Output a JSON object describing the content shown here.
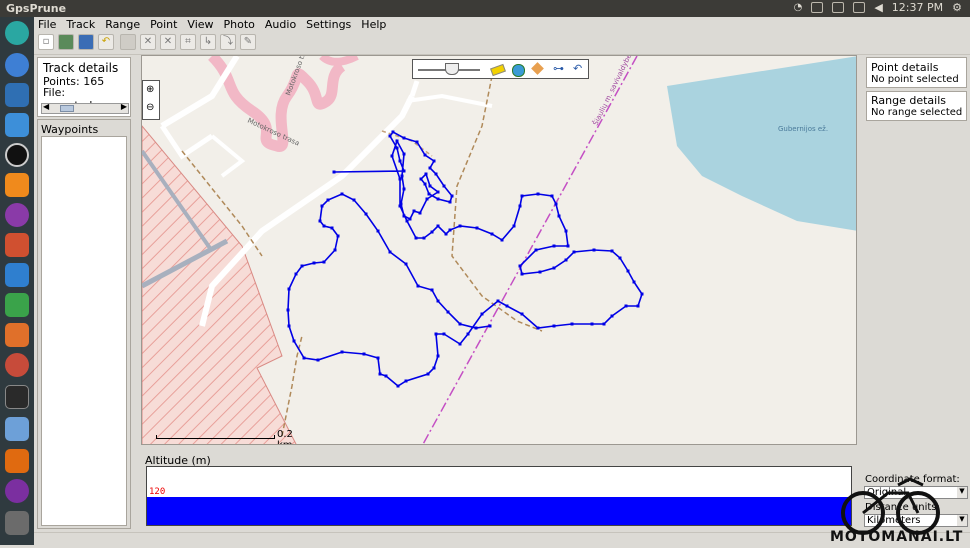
{
  "window": {
    "title": "GpsPrune"
  },
  "system_tray": {
    "time": "12:37 PM"
  },
  "menu": [
    {
      "label": "File",
      "key": "F"
    },
    {
      "label": "Track",
      "key": "T"
    },
    {
      "label": "Range",
      "key": "R"
    },
    {
      "label": "Point",
      "key": "P"
    },
    {
      "label": "View",
      "key": "V"
    },
    {
      "label": "Photo",
      "key": "h"
    },
    {
      "label": "Audio",
      "key": "A"
    },
    {
      "label": "Settings",
      "key": "S"
    },
    {
      "label": "Help",
      "key": "H"
    }
  ],
  "left_panel": {
    "track_details": {
      "heading": "Track details",
      "points": "Points: 165",
      "file": "File: exported...."
    },
    "waypoints_heading": "Waypoints"
  },
  "right_panel": {
    "point_details": {
      "heading": "Point details",
      "status": "No point selected"
    },
    "range_details": {
      "heading": "Range details",
      "status": "No range selected"
    },
    "coord_format": {
      "label": "Coordinate format:",
      "value": "Original"
    },
    "distance_units": {
      "label": "Distance units:",
      "value": "Kilometers"
    }
  },
  "map": {
    "scale_label": "0.2 km",
    "labels": {
      "street1": "Motokroso trasa",
      "street2": "Motokroso trasa",
      "rail": "Šiaulių m. savivaldybė",
      "lake": "Gubernijos ež."
    }
  },
  "altitude": {
    "heading": "Altitude (m)",
    "value_label": "120"
  },
  "watermark": {
    "text": "MOTOMANAI.LT"
  },
  "colors": {
    "track": "#0000e6",
    "altitude_fill": "#0000ff",
    "forest_hatch": "#e8a09a",
    "water": "#aad3df"
  },
  "icons": [
    "new-file-icon",
    "open-photo-icon",
    "save-icon",
    "undo-icon",
    "edit-icon",
    "delete-point-icon",
    "delete-range-icon",
    "crop-icon",
    "compress-icon",
    "zoom-in-icon",
    "zoom-out-icon",
    "slider-icon",
    "ruler-icon",
    "globe-icon",
    "map-icon",
    "connect-icon",
    "pan-icon"
  ]
}
